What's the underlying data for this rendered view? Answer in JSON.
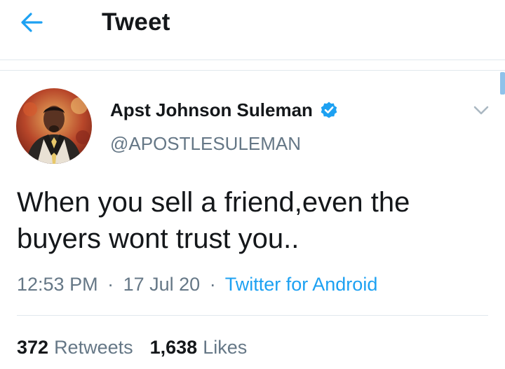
{
  "header": {
    "title": "Tweet",
    "back_icon": "arrow-left-icon"
  },
  "tweet": {
    "author": {
      "display_name": "Apst Johnson Suleman",
      "handle": "@APOSTLESULEMAN",
      "verified": true
    },
    "text": "When you sell a friend,even the buyers wont trust you..",
    "time": "12:53 PM",
    "separator": "·",
    "date": "17 Jul 20",
    "source": "Twitter for Android",
    "stats": {
      "retweets_count": "372",
      "retweets_label": "Retweets",
      "likes_count": "1,638",
      "likes_label": "Likes"
    }
  },
  "colors": {
    "accent": "#1da1f2",
    "text_primary": "#14171a",
    "text_secondary": "#657786",
    "divider": "#e1e8ed"
  }
}
